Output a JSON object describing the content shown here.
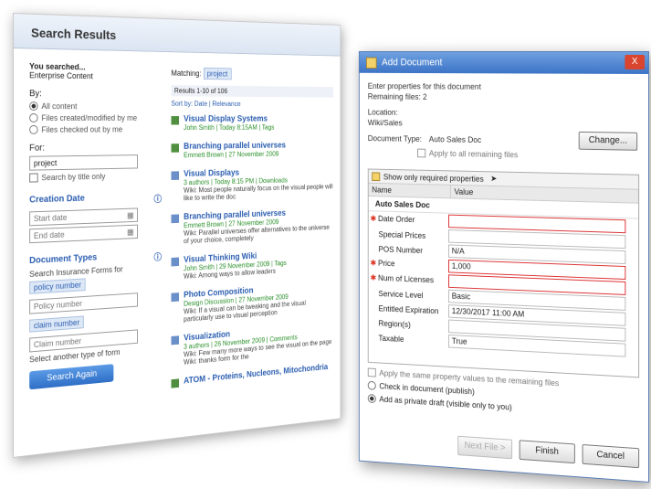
{
  "search": {
    "title": "Search Results",
    "searched_line": "You searched...",
    "entered_content": "Enterprise Content",
    "by_label": "By:",
    "options": [
      "All content",
      "Files created/modified by me",
      "Files checked out by me"
    ],
    "for_label": "For:",
    "for_value": "project",
    "title_only": "Search by title only",
    "creation_date_label": "Creation Date",
    "start_date": "Start date",
    "end_date": "End date",
    "doc_types_label": "Document Types",
    "search_forms_text": "Search Insurance Forms for",
    "policy_tag": "policy number",
    "policy_placeholder": "Policy number",
    "claim_tag": "claim number",
    "claim_placeholder": "Claim number",
    "select_another": "Select another type of form",
    "search_again": "Search Again",
    "matching_label": "Matching:",
    "matching_value": "project",
    "results_range": "Results 1-10 of 106",
    "sort_label": "Sort by: Date | Relevance",
    "results": [
      {
        "title": "Visual Display Systems",
        "meta": "John Smith | Today 8:15AM | Tags",
        "desc": ""
      },
      {
        "title": "Branching parallel universes",
        "meta": "Emmett Brown | 27 November 2009",
        "desc": ""
      },
      {
        "title": "Visual Displays",
        "meta": "3 authors | Today 8:15 PM | Downloads",
        "desc": "Wiki: Most people naturally focus on the visual people will like to write the doc"
      },
      {
        "title": "Branching parallel universes",
        "meta": "Emmett Brown | 27 November 2009",
        "desc": "Wiki: Parallel universes offer alternatives to the universe of your choice, completely"
      },
      {
        "title": "Visual Thinking Wiki",
        "meta": "John Smith | 29 November 2009 | Tags",
        "desc": "Wiki: Among ways to allow leaders"
      },
      {
        "title": "Photo Composition",
        "meta": "Design Discussion | 27 November 2009",
        "desc": "Wiki: If a visual can be tweaking and the visual particularly use to visual perception"
      },
      {
        "title": "Visualization",
        "meta": "3 authors | 26 November 2009 | Comments",
        "desc": "Wiki: Few many more ways to see the visual on the page Wiki: thanks form for the"
      },
      {
        "title": "ATOM - Proteins, Nucleons, Mitochondria",
        "meta": "",
        "desc": ""
      }
    ]
  },
  "dialog": {
    "title": "Add Document",
    "close": "X",
    "intro1": "Enter properties for this document",
    "intro2": "Remaining files: 2",
    "location_label": "Location:",
    "location_value": "Wiki/Sales",
    "doc_type_label": "Document Type:",
    "doc_type_value": "Auto Sales Doc",
    "change_button": "Change...",
    "apply_remaining": "Apply to all remaining files",
    "show_required": "Show only required properties",
    "col_name": "Name",
    "col_value": "Value",
    "group": "Auto Sales Doc",
    "props": [
      {
        "name": "Date Order",
        "value": "",
        "required": true,
        "red": true
      },
      {
        "name": "Special Prices",
        "value": "",
        "required": false,
        "red": false
      },
      {
        "name": "POS Number",
        "value": "N/A",
        "required": false,
        "red": false
      },
      {
        "name": "Price",
        "value": "1,000",
        "required": true,
        "red": true
      },
      {
        "name": "Num of Licenses",
        "value": "",
        "required": true,
        "red": true
      },
      {
        "name": "Service Level",
        "value": "Basic",
        "required": false,
        "red": false
      },
      {
        "name": "Entitled Expiration",
        "value": "12/30/2017 11:00 AM",
        "required": false,
        "red": false
      },
      {
        "name": "Region(s)",
        "value": "",
        "required": false,
        "red": false
      },
      {
        "name": "Taxable",
        "value": "True",
        "required": false,
        "red": false
      }
    ],
    "apply_same": "Apply the same property values to the remaining files",
    "checkin": "Check in document (publish)",
    "draft": "Add as private draft (visible only to you)",
    "next_file": "Next File >",
    "finish": "Finish",
    "cancel": "Cancel"
  }
}
